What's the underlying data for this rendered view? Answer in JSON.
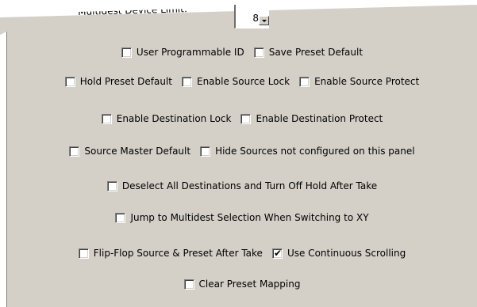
{
  "top_field": {
    "label": "Multidest Device Limit:",
    "value": "8"
  },
  "rows": [
    [
      {
        "label": "User Programmable ID",
        "checked": false
      },
      {
        "label": "Save Preset Default",
        "checked": false
      }
    ],
    [
      {
        "label": "Hold Preset Default",
        "checked": false
      },
      {
        "label": "Enable Source Lock",
        "checked": false
      },
      {
        "label": "Enable Source Protect",
        "checked": false
      }
    ],
    [
      {
        "label": "Enable Destination Lock",
        "checked": false
      },
      {
        "label": "Enable Destination Protect",
        "checked": false
      }
    ],
    [
      {
        "label": "Source Master Default",
        "checked": false
      },
      {
        "label": "Hide Sources not configured on this panel",
        "checked": false
      }
    ],
    [
      {
        "label": "Deselect All Destinations and Turn Off Hold After Take",
        "checked": false
      }
    ],
    [
      {
        "label": "Jump to Multidest Selection When Switching to XY",
        "checked": false
      }
    ],
    [
      {
        "label": "Flip-Flop Source & Preset After Take",
        "checked": false
      },
      {
        "label": "Use Continuous Scrolling",
        "checked": true
      }
    ],
    [
      {
        "label": "Clear Preset Mapping",
        "checked": false
      }
    ]
  ]
}
